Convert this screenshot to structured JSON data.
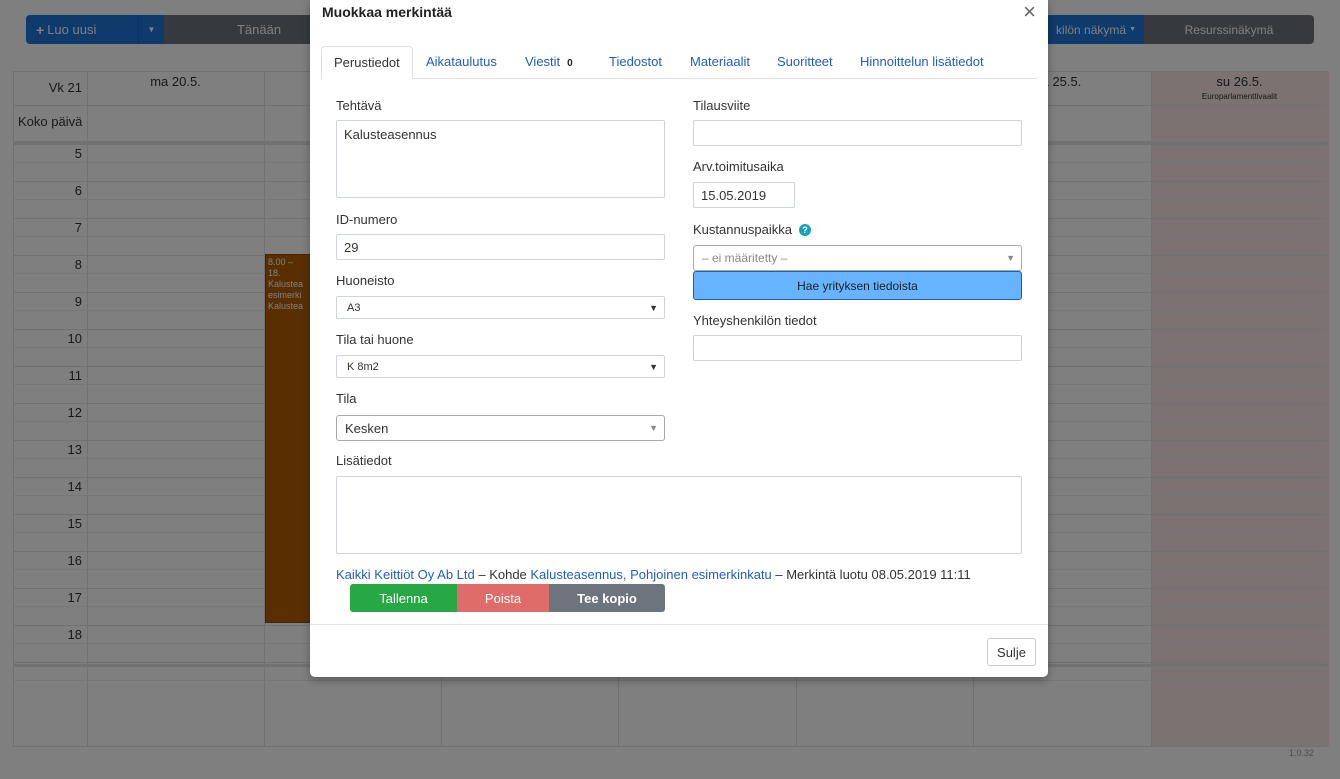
{
  "toolbar": {
    "new_label": "Luo uusi",
    "today_label": "Tänään",
    "person_view_label": "kilön näkymä",
    "resource_view_label": "Resurssinäkymä"
  },
  "calendar": {
    "week_label": "Vk 21",
    "allday_label": "Koko päivä",
    "days": [
      {
        "label": "ma 20.5.",
        "sub": ""
      },
      {
        "label": "",
        "sub": ""
      },
      {
        "label": "",
        "sub": ""
      },
      {
        "label": "",
        "sub": ""
      },
      {
        "label": "",
        "sub": ""
      },
      {
        "label": "a 25.5.",
        "sub": ""
      },
      {
        "label": "su 26.5.",
        "sub": "Europarlamenttivaalit"
      }
    ],
    "hours": [
      "5",
      "6",
      "7",
      "8",
      "9",
      "10",
      "11",
      "12",
      "13",
      "14",
      "15",
      "16",
      "17",
      "18"
    ],
    "event": {
      "time": "8.00 – 18.",
      "lines": [
        "Kalustea",
        "esimerki",
        "Kalustea"
      ]
    },
    "version": "1.0.32"
  },
  "modal": {
    "title": "Muokkaa merkintää",
    "tabs": [
      {
        "label": "Perustiedot",
        "active": true
      },
      {
        "label": "Aikataulutus",
        "active": false
      },
      {
        "label": "Viestit",
        "active": false,
        "badge": "0"
      },
      {
        "label": "Tiedostot",
        "active": false
      },
      {
        "label": "Materiaalit",
        "active": false
      },
      {
        "label": "Suoritteet",
        "active": false
      },
      {
        "label": "Hinnoittelun lisätiedot",
        "active": false
      }
    ],
    "fields": {
      "task_label": "Tehtävä",
      "task_value": "Kalusteasennus",
      "id_label": "ID-numero",
      "id_value": "29",
      "apartment_label": "Huoneisto",
      "apartment_value": "A3",
      "room_label": "Tila tai huone",
      "room_value": "K 8m2",
      "status_label": "Tila",
      "status_value": "Kesken",
      "order_ref_label": "Tilausviite",
      "order_ref_value": "",
      "delivery_label": "Arv.toimitusaika",
      "delivery_value": "15.05.2019",
      "cost_center_label": "Kustannuspaikka",
      "cost_center_value": "– ei määritetty –",
      "fetch_button": "Hae yrityksen tiedoista",
      "contact_label": "Yhteyshenkilön tiedot",
      "contact_value": "",
      "notes_label": "Lisätiedot",
      "notes_value": ""
    },
    "footer_info": {
      "company": "Kaikki Keittiöt Oy Ab Ltd",
      "sep1": " – Kohde ",
      "target": "Kalusteasennus, Pohjoinen esimerkinkatu",
      "created": " – Merkintä luotu 08.05.2019 11:11"
    },
    "actions": {
      "save": "Tallenna",
      "delete": "Poista",
      "copy": "Tee kopio"
    },
    "close_label": "Sulje"
  }
}
